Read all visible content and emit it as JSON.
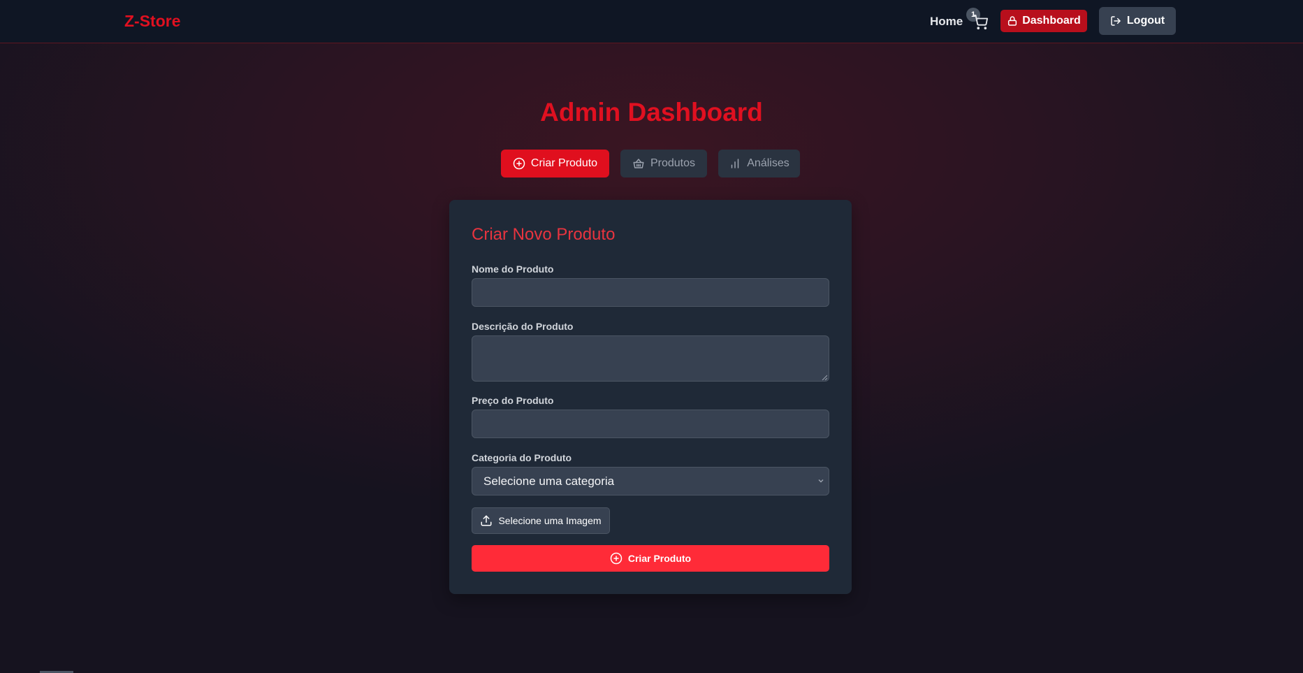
{
  "navbar": {
    "brand": "Z-Store",
    "home_label": "Home",
    "cart_count": "1",
    "dashboard_label": "Dashboard",
    "logout_label": "Logout"
  },
  "page": {
    "title": "Admin Dashboard"
  },
  "tabs": [
    {
      "label": "Criar Produto",
      "icon": "plus-circle-icon",
      "active": true
    },
    {
      "label": "Produtos",
      "icon": "basket-icon",
      "active": false
    },
    {
      "label": "Análises",
      "icon": "bar-chart-icon",
      "active": false
    }
  ],
  "form": {
    "title": "Criar Novo Produto",
    "name_label": "Nome do Produto",
    "name_value": "",
    "description_label": "Descrição do Produto",
    "description_value": "",
    "price_label": "Preço do Produto",
    "price_value": "",
    "category_label": "Categoria do Produto",
    "category_selected": "Selecione uma categoria",
    "upload_label": "Selecione uma Imagem",
    "submit_label": "Criar Produto"
  },
  "colors": {
    "accent": "#e00f1e",
    "submit": "#ff2b38",
    "card": "#1f2937",
    "input": "#374151",
    "navbar": "#0f1624"
  }
}
